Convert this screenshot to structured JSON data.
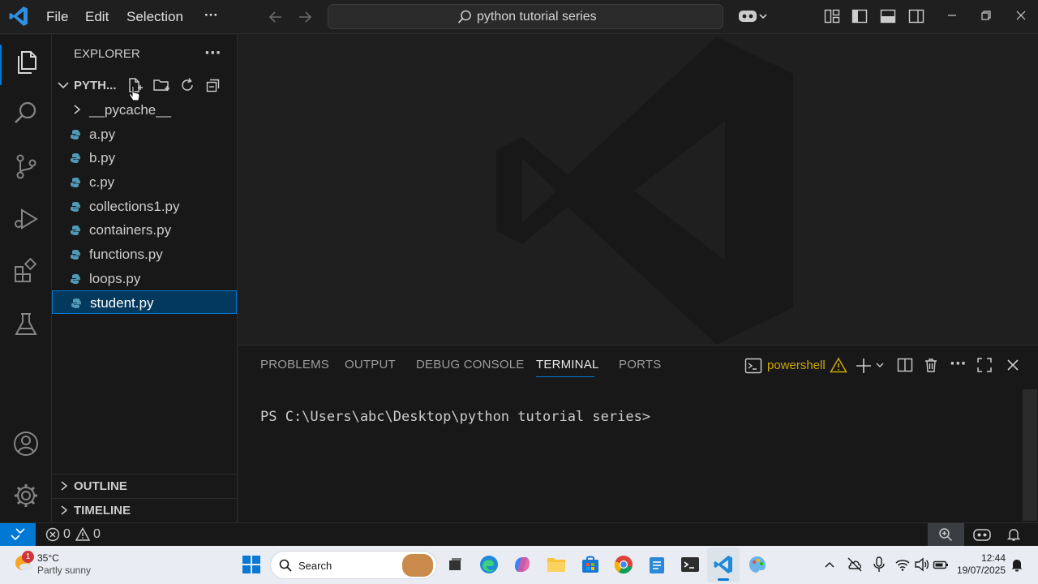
{
  "titlebar": {
    "menus": [
      "File",
      "Edit",
      "Selection",
      "···"
    ],
    "search_text": "python tutorial series"
  },
  "explorer": {
    "title": "EXPLORER",
    "folder": "PYTH...",
    "folder_items": [
      "__pycache__"
    ],
    "files": [
      "a.py",
      "b.py",
      "c.py",
      "collections1.py",
      "containers.py",
      "functions.py",
      "loops.py",
      "student.py"
    ],
    "selected_file": "student.py",
    "sections": [
      "OUTLINE",
      "TIMELINE"
    ]
  },
  "panel": {
    "tabs": [
      "PROBLEMS",
      "OUTPUT",
      "DEBUG CONSOLE",
      "TERMINAL",
      "PORTS"
    ],
    "active_tab": "TERMINAL",
    "shell": "powershell",
    "prompt": "PS C:\\Users\\abc\\Desktop\\python tutorial series>"
  },
  "statusbar": {
    "errors": "0",
    "warnings": "0"
  },
  "taskbar": {
    "weather_temp": "35°C",
    "weather_desc": "Partly sunny",
    "weather_badge": "1",
    "search_label": "Search",
    "time": "12:44",
    "date": "19/07/2025"
  },
  "colors": {
    "accent": "#0078d4",
    "selection": "#04395e",
    "warning": "#cca700",
    "python_icon": "#519aba"
  }
}
